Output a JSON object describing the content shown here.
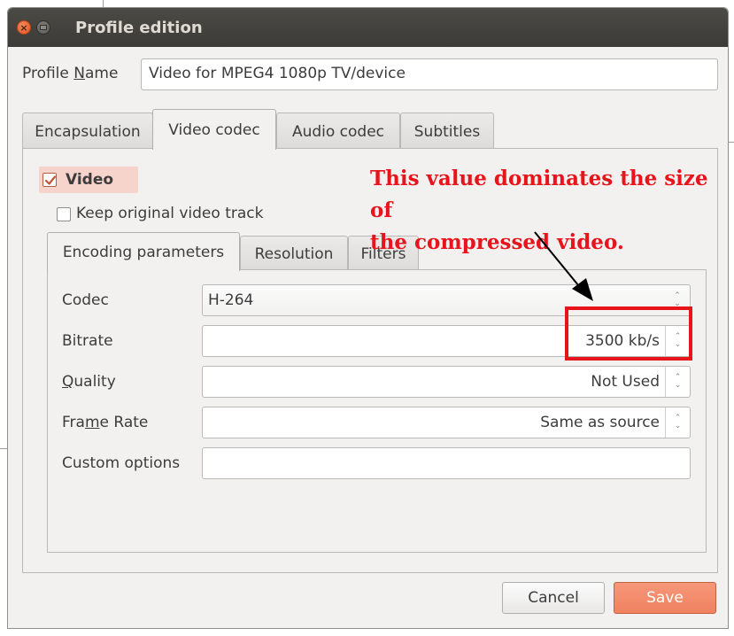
{
  "window": {
    "title": "Profile edition"
  },
  "profile": {
    "label_pre": "Profile ",
    "label_mnemonic": "N",
    "label_post": "ame",
    "value": "Video for MPEG4 1080p TV/device"
  },
  "main_tabs": [
    {
      "label": "Encapsulation",
      "active": false
    },
    {
      "label": "Video codec",
      "active": true
    },
    {
      "label": "Audio codec",
      "active": false
    },
    {
      "label": "Subtitles",
      "active": false
    }
  ],
  "video": {
    "label": "Video",
    "checked": true,
    "keep_original_label": "Keep original video track",
    "keep_original_checked": false
  },
  "sub_tabs": [
    {
      "label": "Encoding parameters",
      "active": true
    },
    {
      "label": "Resolution",
      "active": false
    },
    {
      "label": "Filters",
      "active": false
    }
  ],
  "encoding": {
    "codec_label": "Codec",
    "codec_value": "H-264",
    "bitrate_label": "Bitrate",
    "bitrate_value": "3500 kb/s",
    "quality_label_mnemonic": "Q",
    "quality_label_rest": "uality",
    "quality_value": "Not Used",
    "framerate_label_pre": "Fra",
    "framerate_label_mnemonic": "m",
    "framerate_label_post": "e Rate",
    "framerate_value": "Same as source",
    "custom_label": "Custom options",
    "custom_value": ""
  },
  "buttons": {
    "cancel": "Cancel",
    "save": "Save"
  },
  "annotation": {
    "line1": "This value dominates the size of",
    "line2": "the compressed video.",
    "color": "#e8141c"
  },
  "icons": {
    "close": "close-icon",
    "minimize": "minimize-icon",
    "spinner": "spin-arrows-icon",
    "check": "check-icon",
    "arrow": "annotation-arrow-icon"
  }
}
